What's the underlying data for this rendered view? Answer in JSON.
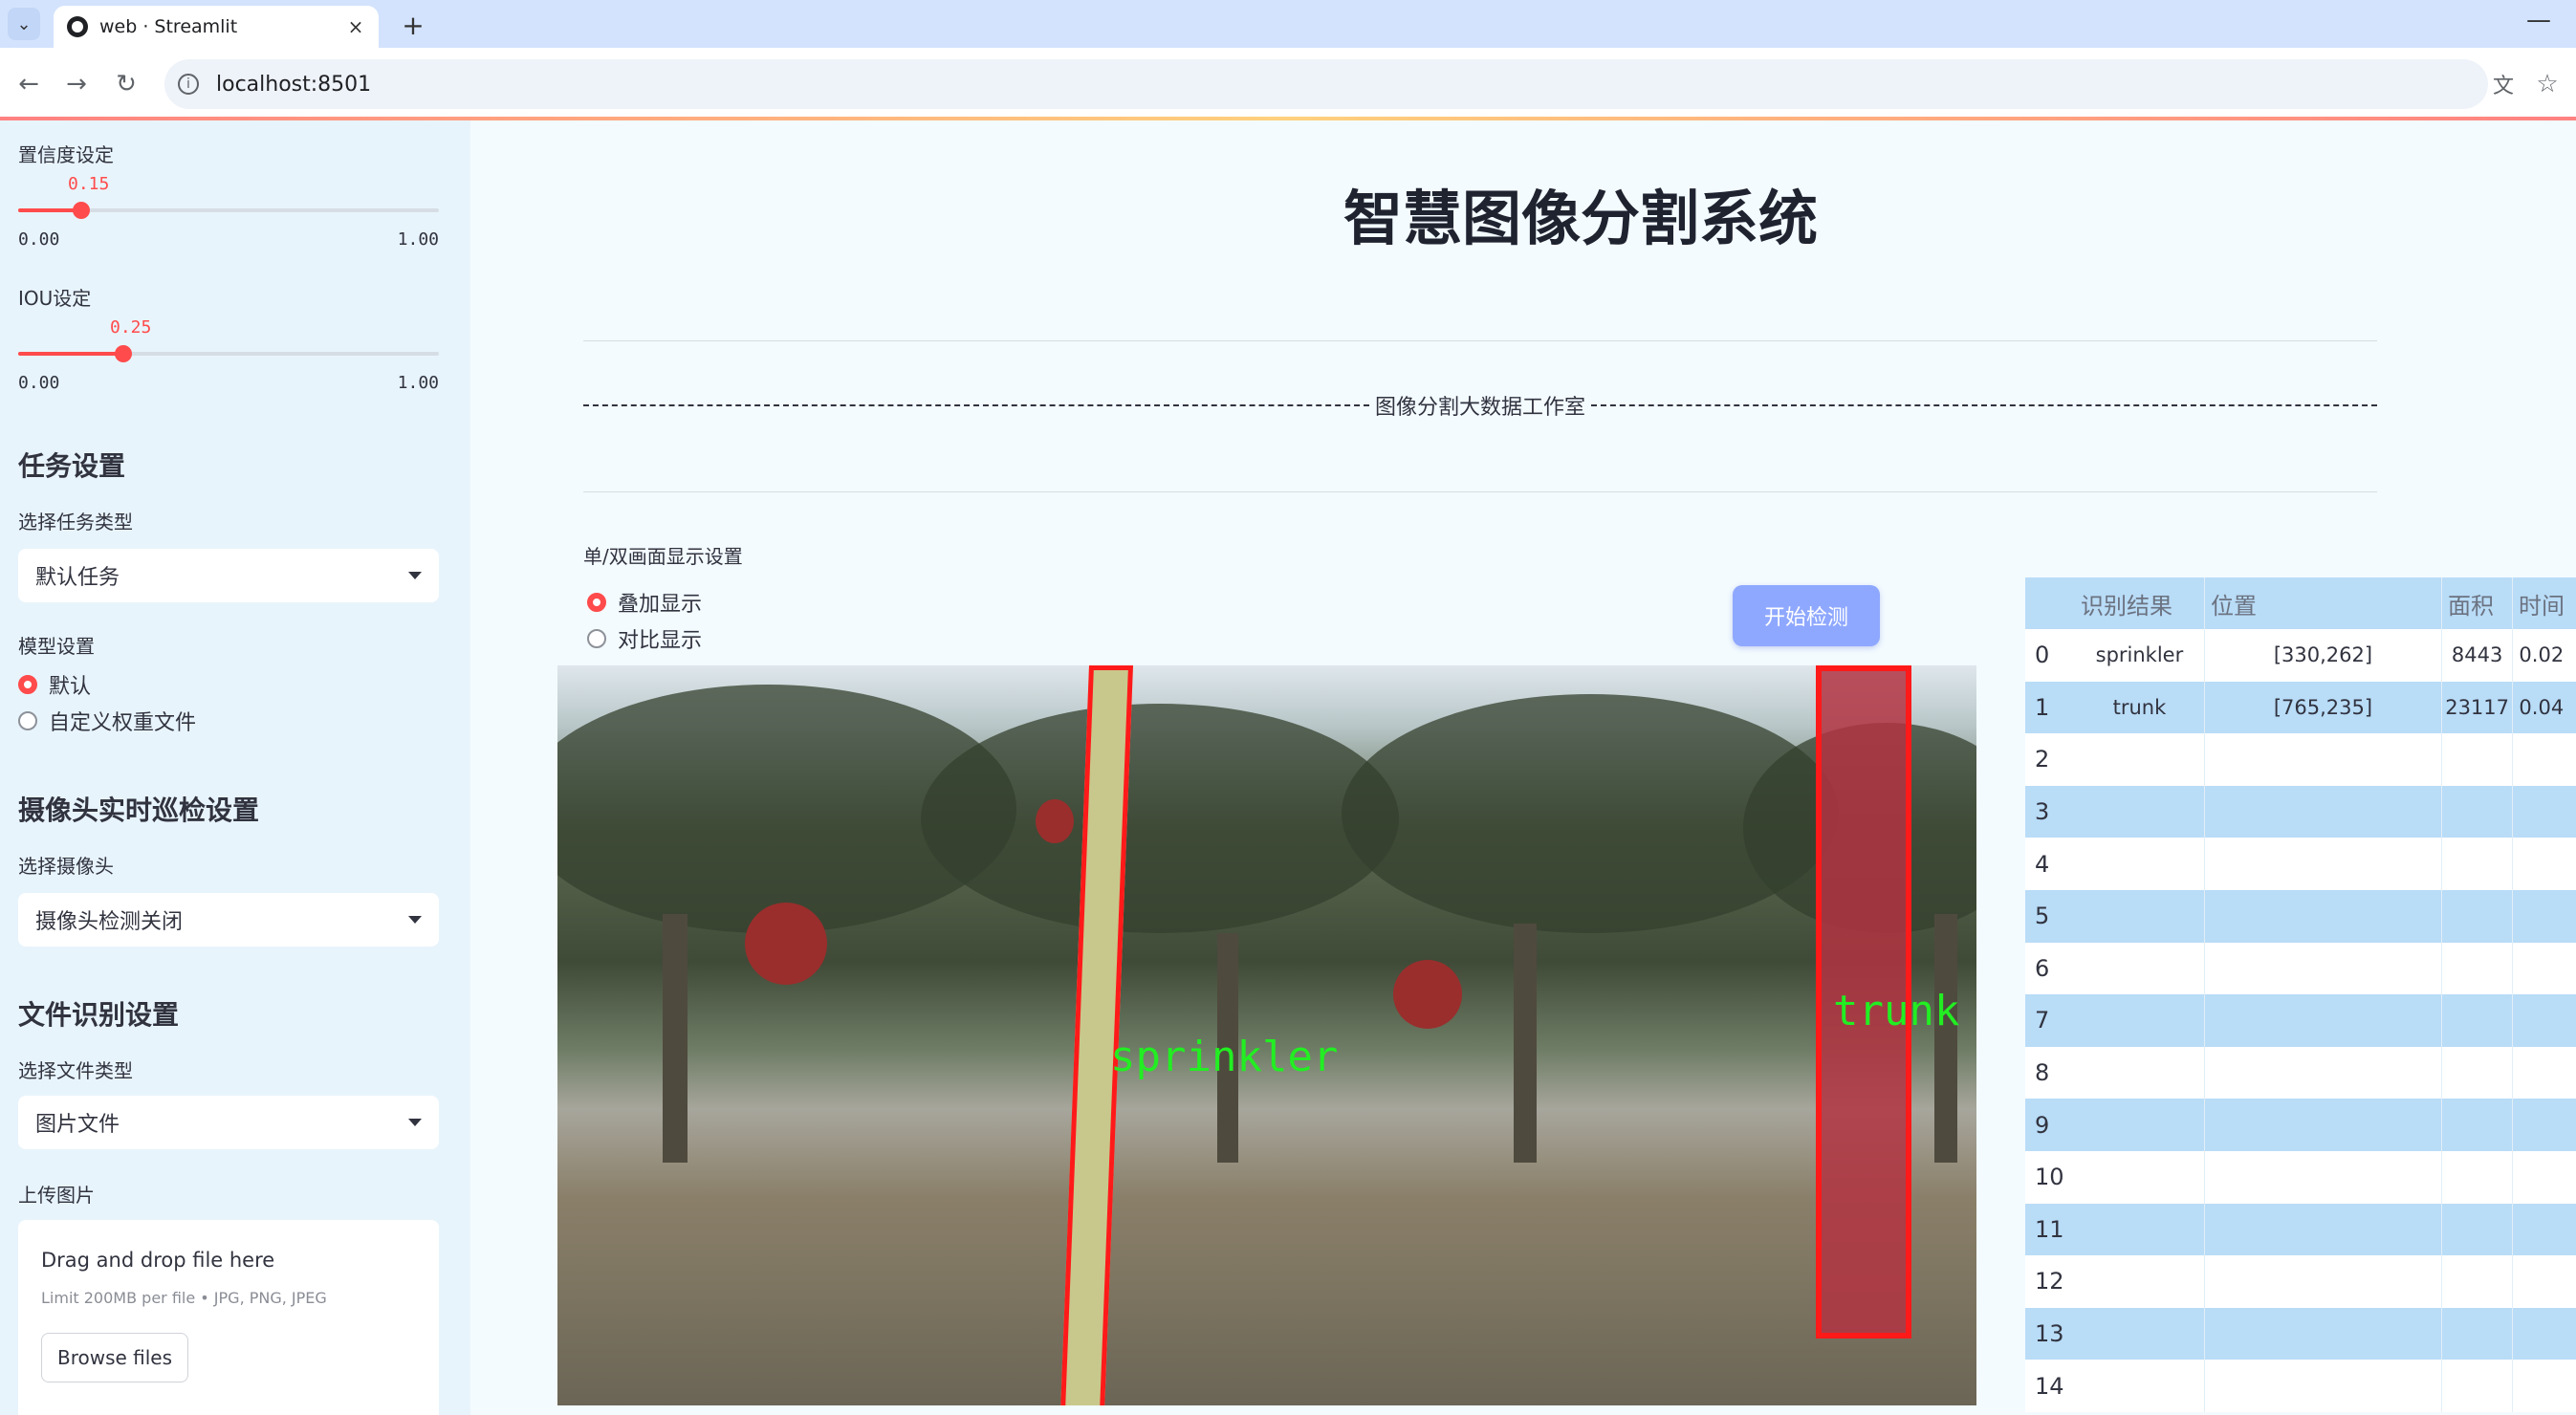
{
  "browser": {
    "tab_title": "web · Streamlit",
    "url": "localhost:8501",
    "new_tab": "+",
    "close": "×",
    "minimize": "—"
  },
  "sidebar": {
    "confidence": {
      "label": "置信度设定",
      "value": "0.15",
      "value_num": 0.15,
      "min": "0.00",
      "max": "1.00"
    },
    "iou": {
      "label": "IOU设定",
      "value": "0.25",
      "value_num": 0.25,
      "min": "0.00",
      "max": "1.00"
    },
    "task": {
      "heading": "任务设置",
      "label": "选择任务类型",
      "selected": "默认任务"
    },
    "model": {
      "label": "模型设置",
      "options": [
        "默认",
        "自定义权重文件"
      ],
      "selected_index": 0
    },
    "camera": {
      "heading": "摄像头实时巡检设置",
      "label": "选择摄像头",
      "selected": "摄像头检测关闭"
    },
    "file": {
      "heading": "文件识别设置",
      "label": "选择文件类型",
      "selected": "图片文件"
    },
    "upload": {
      "label": "上传图片",
      "title": "Drag and drop file here",
      "limit": "Limit 200MB per file • JPG, PNG, JPEG",
      "button": "Browse files"
    }
  },
  "main": {
    "title": "智慧图像分割系统",
    "studio": "图像分割大数据工作室",
    "display_label": "单/双画面显示设置",
    "display_options": [
      "叠加显示",
      "对比显示"
    ],
    "display_selected_index": 0,
    "detect_button": "开始检测",
    "detections": [
      {
        "label": "sprinkler"
      },
      {
        "label": "trunk"
      }
    ]
  },
  "table": {
    "headers": [
      "",
      "识别结果",
      "位置",
      "面积",
      "时间"
    ],
    "rows": [
      {
        "index": "0",
        "result": "sprinkler",
        "position": "[330,262]",
        "area": "8443",
        "time": "0.02"
      },
      {
        "index": "1",
        "result": "trunk",
        "position": "[765,235]",
        "area": "23117",
        "time": "0.04"
      },
      {
        "index": "2",
        "result": "",
        "position": "",
        "area": "",
        "time": ""
      },
      {
        "index": "3",
        "result": "",
        "position": "",
        "area": "",
        "time": ""
      },
      {
        "index": "4",
        "result": "",
        "position": "",
        "area": "",
        "time": ""
      },
      {
        "index": "5",
        "result": "",
        "position": "",
        "area": "",
        "time": ""
      },
      {
        "index": "6",
        "result": "",
        "position": "",
        "area": "",
        "time": ""
      },
      {
        "index": "7",
        "result": "",
        "position": "",
        "area": "",
        "time": ""
      },
      {
        "index": "8",
        "result": "",
        "position": "",
        "area": "",
        "time": ""
      },
      {
        "index": "9",
        "result": "",
        "position": "",
        "area": "",
        "time": ""
      },
      {
        "index": "10",
        "result": "",
        "position": "",
        "area": "",
        "time": ""
      },
      {
        "index": "11",
        "result": "",
        "position": "",
        "area": "",
        "time": ""
      },
      {
        "index": "12",
        "result": "",
        "position": "",
        "area": "",
        "time": ""
      },
      {
        "index": "13",
        "result": "",
        "position": "",
        "area": "",
        "time": ""
      },
      {
        "index": "14",
        "result": "",
        "position": "",
        "area": "",
        "time": ""
      }
    ]
  },
  "colors": {
    "accent": "#ff4b4b",
    "button": "#8fa8ff",
    "mask_outline": "#ff1a1a",
    "label_green": "#22ee22"
  }
}
